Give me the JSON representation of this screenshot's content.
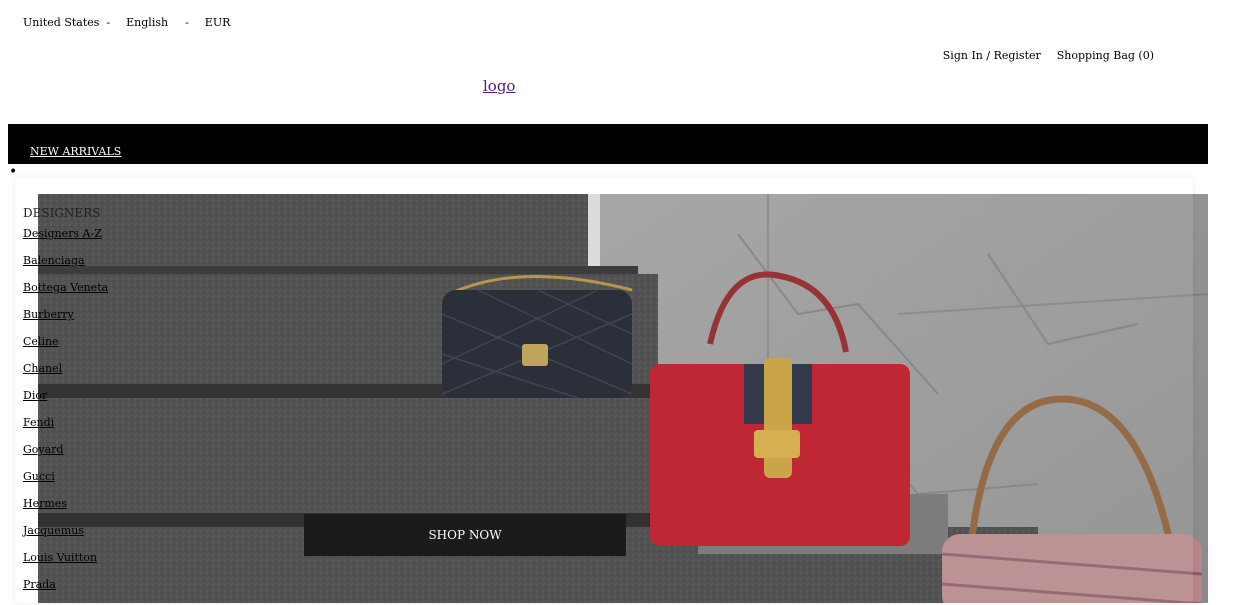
{
  "topbar": {
    "country": "United States",
    "sep1": "  -",
    "language": "English",
    "sep2": "-",
    "currency": "EUR"
  },
  "account": {
    "sign_in": "Sign In / Register",
    "bag": "Shopping Bag (0)"
  },
  "logo": {
    "text": "logo"
  },
  "nav": {
    "new_arrivals": "NEW ARRIVALS"
  },
  "menu": {
    "bullet": "•",
    "heading": "DESIGNERS",
    "items": [
      "Designers A-Z",
      "Balenciaga",
      "Bottega Veneta",
      "Burberry",
      "Celine",
      "Chanel",
      "Dior",
      "Fendi",
      "Goyard",
      "Gucci",
      "Hermes",
      "Jacquemus",
      "Louis Vuitton",
      "Prada"
    ]
  },
  "hero": {
    "cta": "SHOP NOW"
  }
}
